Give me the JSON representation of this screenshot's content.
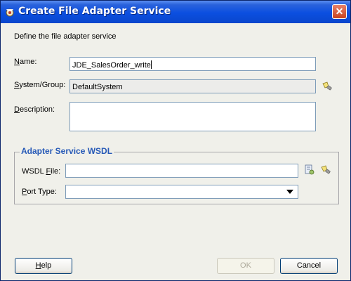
{
  "window": {
    "title": "Create File Adapter Service"
  },
  "intro": "Define the file adapter service",
  "form": {
    "name": {
      "label_u": "N",
      "label_rest": "ame:",
      "value": "JDE_SalesOrder_write"
    },
    "system_group": {
      "label_u": "S",
      "label_rest": "ystem/Group:",
      "value": "DefaultSystem"
    },
    "description": {
      "label_u": "D",
      "label_rest": "escription:",
      "value": ""
    }
  },
  "wsdl_group": {
    "title": "Adapter Service WSDL",
    "wsdl_file": {
      "label_pre": "WSDL ",
      "label_u": "F",
      "label_rest": "ile:",
      "value": ""
    },
    "port_type": {
      "label_u": "P",
      "label_rest": "ort Type:",
      "selected": ""
    }
  },
  "buttons": {
    "help": {
      "u": "H",
      "rest": "elp"
    },
    "ok": "OK",
    "cancel": "Cancel"
  },
  "icons": {
    "title": "gear-icon",
    "browse": "flashlight-icon",
    "service": "service-explorer-icon",
    "close": "close-icon"
  }
}
